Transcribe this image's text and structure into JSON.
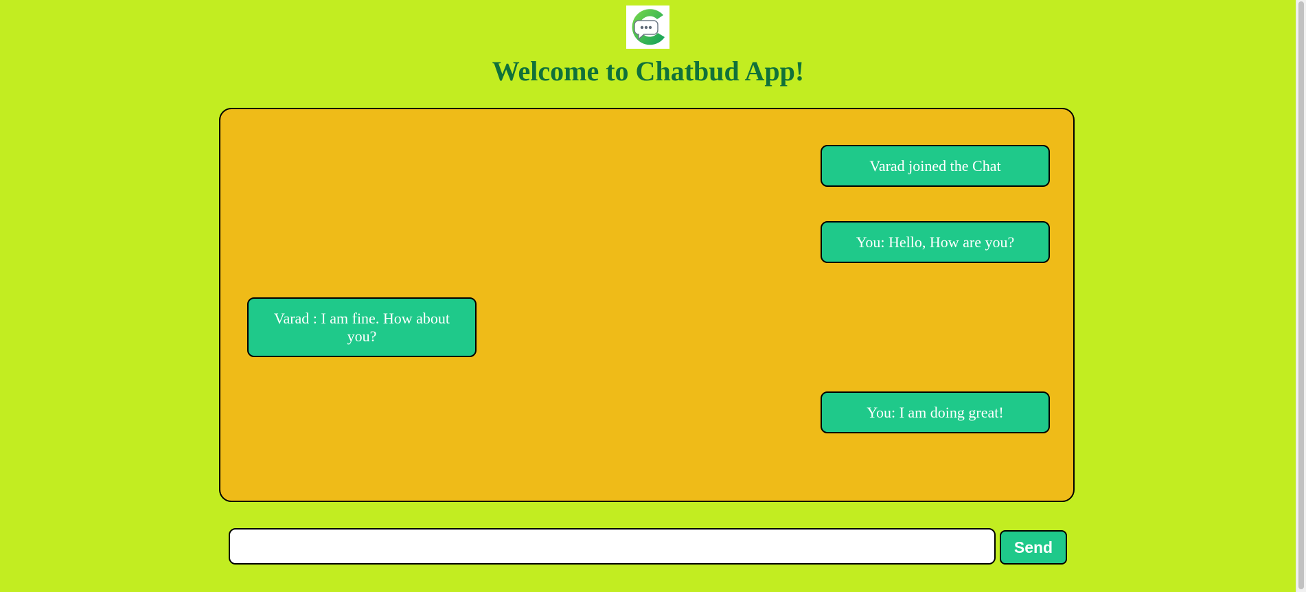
{
  "app": {
    "title": "Welcome to Chatbud App!",
    "logo_icon": "chat-bubble-logo-icon"
  },
  "messages": [
    {
      "text": "Varad joined the Chat",
      "position": "right"
    },
    {
      "text": "You: Hello, How are you?",
      "position": "right"
    },
    {
      "text": "Varad : I am fine. How about you?",
      "position": "left"
    },
    {
      "text": "You: I am doing great!",
      "position": "right"
    }
  ],
  "composer": {
    "input_value": "",
    "send_label": "Send"
  },
  "colors": {
    "background": "#c2ed21",
    "title": "#10713a",
    "chat_box": "#efbb18",
    "bubble": "#1fc98a",
    "bubble_text": "#ffffff"
  }
}
